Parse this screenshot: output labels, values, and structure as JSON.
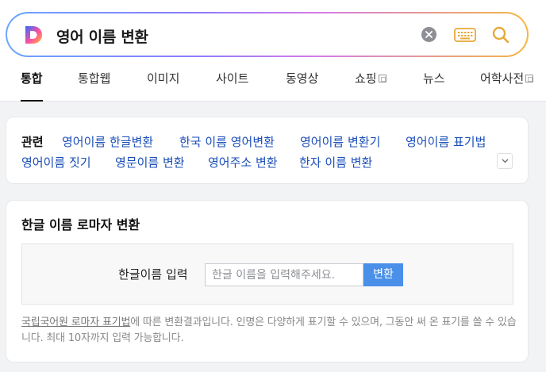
{
  "search": {
    "query": "영어 이름 변환",
    "logo_letter": "D",
    "colors": {
      "logo_left": "#2f6bff",
      "logo_mid": "#ff4fa0",
      "logo_right": "#ffc02b"
    }
  },
  "tabs": [
    {
      "label": "통합",
      "active": true
    },
    {
      "label": "통합웹"
    },
    {
      "label": "이미지"
    },
    {
      "label": "사이트"
    },
    {
      "label": "동영상"
    },
    {
      "label": "쇼핑",
      "external": true
    },
    {
      "label": "뉴스"
    },
    {
      "label": "어학사전",
      "external": true
    }
  ],
  "related": {
    "title": "관련",
    "items": [
      "영어이름 한글변환",
      "한국 이름 영어변환",
      "영어이름 변환기",
      "영어이름 표기법",
      "영어이름 짓기",
      "영문이름 변환",
      "영어주소 변환",
      "한자 이름 변환"
    ]
  },
  "converter": {
    "title": "한글 이름 로마자 변환",
    "input_label": "한글이름 입력",
    "input_placeholder": "한글 이름을 입력해주세요.",
    "button_label": "변환",
    "note_link": "국립국어원 로마자 표기법",
    "note_text": "에 따른 변환결과입니다. 인명은 다양하게 표기할 수 있으며, 그동안 써 온 표기를 쓸 수 있습니다. 최대 10자까지 입력 가능합니다."
  }
}
